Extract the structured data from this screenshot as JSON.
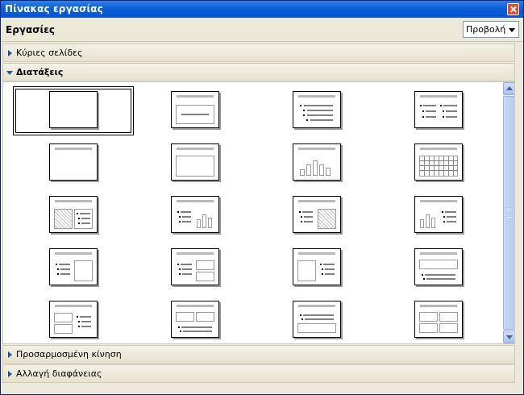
{
  "window": {
    "title": "Πίνακας εργασίας"
  },
  "toolbar": {
    "title": "Εργασίες",
    "view_label": "Προβολή"
  },
  "sections": [
    {
      "label": "Κύριες σελίδες",
      "expanded": false
    },
    {
      "label": "Διατάξεις",
      "expanded": true
    },
    {
      "label": "Προσαρμοσμένη κίνηση",
      "expanded": false
    },
    {
      "label": "Αλλαγή διαφάνειας",
      "expanded": false
    }
  ],
  "layouts": [
    {
      "row": 1,
      "col": 1,
      "type": "blank",
      "selected": true
    },
    {
      "row": 1,
      "col": 2,
      "type": "title-slide",
      "selected": false
    },
    {
      "row": 1,
      "col": 3,
      "type": "title-content",
      "selected": false
    },
    {
      "row": 1,
      "col": 4,
      "type": "title-2-columns",
      "selected": false
    },
    {
      "row": 2,
      "col": 1,
      "type": "title-only",
      "selected": false
    },
    {
      "row": 2,
      "col": 2,
      "type": "title-object",
      "selected": false
    },
    {
      "row": 2,
      "col": 3,
      "type": "title-chart",
      "selected": false
    },
    {
      "row": 2,
      "col": 4,
      "type": "title-table",
      "selected": false
    },
    {
      "row": 3,
      "col": 1,
      "type": "clipart-text",
      "selected": false
    },
    {
      "row": 3,
      "col": 2,
      "type": "text-chart",
      "selected": false
    },
    {
      "row": 3,
      "col": 3,
      "type": "text-clipart",
      "selected": false
    },
    {
      "row": 3,
      "col": 4,
      "type": "chart-text",
      "selected": false
    },
    {
      "row": 4,
      "col": 1,
      "type": "text-object",
      "selected": false
    },
    {
      "row": 4,
      "col": 2,
      "type": "text-2-objects",
      "selected": false
    },
    {
      "row": 4,
      "col": 3,
      "type": "object-text",
      "selected": false
    },
    {
      "row": 4,
      "col": 4,
      "type": "object-over-text",
      "selected": false
    },
    {
      "row": 5,
      "col": 1,
      "type": "2-objects-text",
      "selected": false
    },
    {
      "row": 5,
      "col": 2,
      "type": "2-objects-over-text",
      "selected": false
    },
    {
      "row": 5,
      "col": 3,
      "type": "text-over-object",
      "selected": false
    },
    {
      "row": 5,
      "col": 4,
      "type": "4-objects",
      "selected": false
    }
  ],
  "colors": {
    "titlebar": "#0554d3",
    "panel_bg": "#ece9d8",
    "section_arrow": "#2a4f92"
  }
}
